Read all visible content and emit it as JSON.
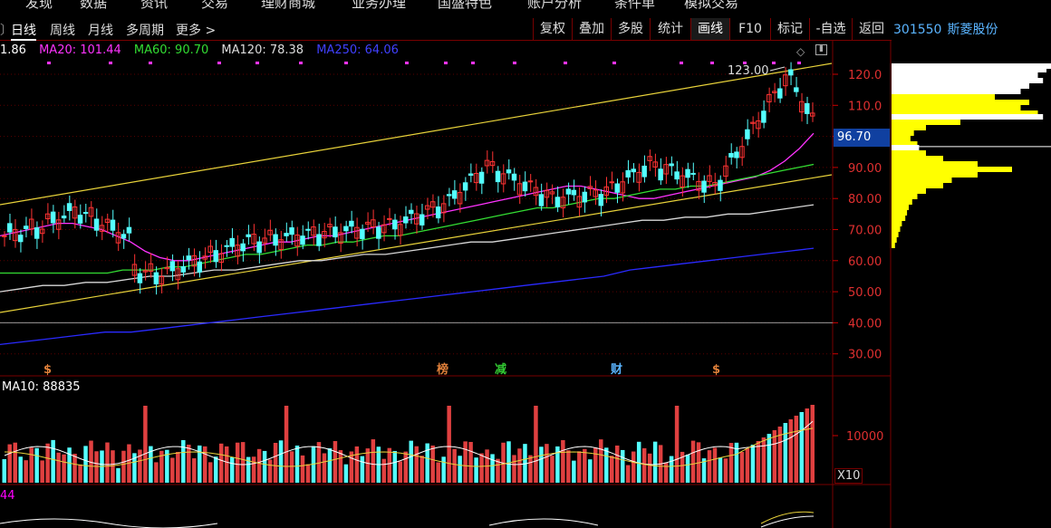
{
  "top_menu": [
    "发现",
    "数据",
    "资讯",
    "交易",
    "理财商城",
    "业务办理",
    "国盛特色",
    "账户分析",
    "条件单",
    "模拟交易"
  ],
  "tabs": [
    {
      "label": "日线",
      "active": true
    },
    {
      "label": "周线",
      "active": false
    },
    {
      "label": "月线",
      "active": false
    },
    {
      "label": "多周期",
      "active": false
    },
    {
      "label": "更多 >",
      "active": false
    }
  ],
  "toolbar": [
    "复权",
    "叠加",
    "多股",
    "统计",
    "画线",
    "F10",
    "标记",
    "-自选",
    "返回"
  ],
  "toolbar_active": "画线",
  "stock": {
    "code": "301550",
    "name": "斯菱股份"
  },
  "ma_legend": [
    {
      "label": "1.86",
      "color": "#ffffff"
    },
    {
      "label": "MA20: 101.44",
      "color": "#ff33ff"
    },
    {
      "label": "MA60: 90.70",
      "color": "#33dd33"
    },
    {
      "label": "MA120: 78.38",
      "color": "#dddddd"
    },
    {
      "label": "MA250: 64.06",
      "color": "#3333ff"
    }
  ],
  "vol_legend": "MA10: 88835",
  "macd_legend": "44",
  "current_price": "96.70",
  "high_marker": "123.00",
  "vol_tick": "10000",
  "vol_multiplier": "X10",
  "event_markers": [
    {
      "label": "$",
      "color": "#e0803a"
    },
    {
      "label": "榜",
      "color": "#e0803a"
    },
    {
      "label": "减",
      "color": "#33cc33"
    },
    {
      "label": "财",
      "color": "#5ab4ff"
    },
    {
      "label": "$",
      "color": "#e0803a"
    }
  ],
  "chart_data": {
    "type": "candlestick",
    "ylim": [
      25,
      127
    ],
    "y_ticks": [
      "120.0",
      "110.0",
      "100.0",
      "90.00",
      "80.00",
      "70.00",
      "60.00",
      "50.00",
      "40.00",
      "30.00"
    ],
    "y_tick_values": [
      120,
      110,
      100,
      90,
      80,
      70,
      60,
      50,
      40,
      30
    ],
    "series": [
      {
        "name": "MA20",
        "values": [
          68,
          69,
          70,
          71,
          72,
          72,
          71,
          70,
          68,
          66,
          63,
          61,
          60,
          60,
          61,
          62,
          63,
          64,
          65,
          66,
          66,
          67,
          68,
          68,
          69,
          70,
          71,
          72,
          73,
          74,
          75,
          76,
          77,
          78,
          79,
          80,
          81,
          82,
          83,
          84,
          84,
          83,
          82,
          81,
          80,
          80,
          81,
          82,
          83,
          84,
          85,
          86,
          87,
          89,
          92,
          96,
          101
        ]
      },
      {
        "name": "MA60",
        "values": [
          56,
          56,
          56,
          56,
          56,
          56,
          56,
          56,
          57,
          57,
          57,
          58,
          58,
          59,
          60,
          61,
          62,
          62,
          63,
          64,
          65,
          65,
          66,
          66,
          67,
          68,
          68,
          69,
          70,
          71,
          72,
          73,
          74,
          75,
          76,
          77,
          77,
          78,
          79,
          80,
          80,
          81,
          82,
          83,
          83,
          84,
          84,
          85,
          86,
          87,
          88,
          89,
          90,
          91
        ]
      },
      {
        "name": "MA120",
        "values": [
          50,
          51,
          52,
          52,
          53,
          53,
          54,
          55,
          55,
          56,
          57,
          57,
          58,
          59,
          60,
          60,
          61,
          62,
          62,
          63,
          64,
          65,
          66,
          66,
          67,
          68,
          69,
          70,
          71,
          72,
          73,
          73,
          74,
          74,
          75,
          75,
          76,
          77,
          78
        ]
      },
      {
        "name": "MA250",
        "values": [
          33,
          34,
          35,
          36,
          37,
          37,
          38,
          39,
          40,
          41,
          42,
          43,
          44,
          45,
          46,
          47,
          48,
          49,
          50,
          51,
          52,
          53,
          54,
          55,
          57,
          58,
          59,
          60,
          61,
          62,
          63,
          64
        ]
      }
    ]
  }
}
